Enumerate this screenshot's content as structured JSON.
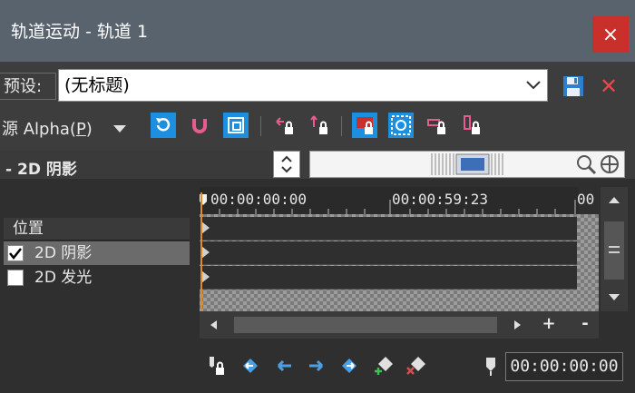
{
  "window": {
    "title": "轨道运动 - 轨道 1",
    "close_glyph": "×"
  },
  "preset": {
    "label": "预设:",
    "value": "(无标题)"
  },
  "source": {
    "label_prefix": "源 Alpha(",
    "label_key": "P",
    "label_suffix": ")"
  },
  "toolbar": {
    "tools": [
      "rotate-icon",
      "magnet-icon",
      "square-frame-icon",
      "move-lock-icon",
      "scale-lock-icon",
      "xy-lock-icon",
      "center-icon",
      "x-lock-icon",
      "y-lock-icon"
    ],
    "active": [
      "rotate-icon",
      "magnet-icon",
      "square-frame-icon",
      "xy-lock-icon",
      "center-icon"
    ]
  },
  "section": {
    "label": "2D 阴影",
    "collapse_glyph": "-"
  },
  "tracks": {
    "header": "位置",
    "items": [
      {
        "label": "2D 阴影",
        "checked": true,
        "selected": true
      },
      {
        "label": "2D 发光",
        "checked": false,
        "selected": false
      }
    ]
  },
  "timeline": {
    "ticks": [
      "00:00:00:00",
      "00:00:59:23",
      "00"
    ],
    "plus_glyph": "+",
    "minus_glyph": "-",
    "cursor_time": "00:00:00:00"
  },
  "colors": {
    "accent": "#1d8fe0",
    "close": "#c9302c",
    "delete": "#e24a4a"
  }
}
